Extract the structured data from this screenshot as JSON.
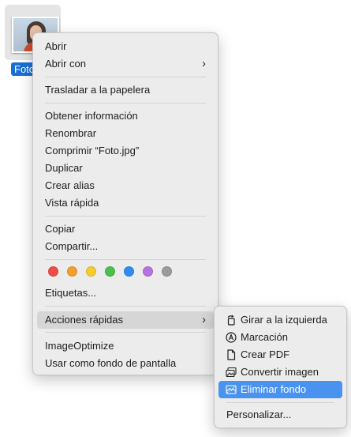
{
  "file": {
    "label": "Foto",
    "thumbnail": "portrait-photo"
  },
  "context_menu": {
    "items": [
      {
        "label": "Abrir"
      },
      {
        "label": "Abrir con",
        "has_submenu": true
      },
      {
        "label": "Trasladar a la papelera"
      },
      {
        "label": "Obtener información"
      },
      {
        "label": "Renombrar"
      },
      {
        "label": "Comprimir “Foto.jpg”"
      },
      {
        "label": "Duplicar"
      },
      {
        "label": "Crear alias"
      },
      {
        "label": "Vista rápida"
      },
      {
        "label": "Copiar"
      },
      {
        "label": "Compartir..."
      },
      {
        "label": "Etiquetas..."
      },
      {
        "label": "Acciones rápidas",
        "has_submenu": true,
        "highlighted": true
      },
      {
        "label": "ImageOptimize"
      },
      {
        "label": "Usar como fondo de pantalla"
      }
    ],
    "tag_colors": [
      {
        "name": "red",
        "hex": "#ee4b47"
      },
      {
        "name": "orange",
        "hex": "#f59e2c"
      },
      {
        "name": "yellow",
        "hex": "#f6cc2c"
      },
      {
        "name": "green",
        "hex": "#4dbf4a"
      },
      {
        "name": "blue",
        "hex": "#2f8cf4"
      },
      {
        "name": "purple",
        "hex": "#b673de"
      },
      {
        "name": "gray",
        "hex": "#9b9b9d"
      }
    ],
    "chevron": "›"
  },
  "quick_actions_menu": {
    "items": [
      {
        "label": "Girar a la izquierda",
        "icon": "rotate-left-icon"
      },
      {
        "label": "Marcación",
        "icon": "markup-icon"
      },
      {
        "label": "Crear PDF",
        "icon": "document-icon"
      },
      {
        "label": "Convertir imagen",
        "icon": "convert-image-icon"
      },
      {
        "label": "Eliminar fondo",
        "icon": "remove-background-icon",
        "selected": true
      },
      {
        "label": "Personalizar..."
      }
    ]
  },
  "colors": {
    "selection": "#4a92f0",
    "file_label_bg": "#1a6fd6"
  }
}
